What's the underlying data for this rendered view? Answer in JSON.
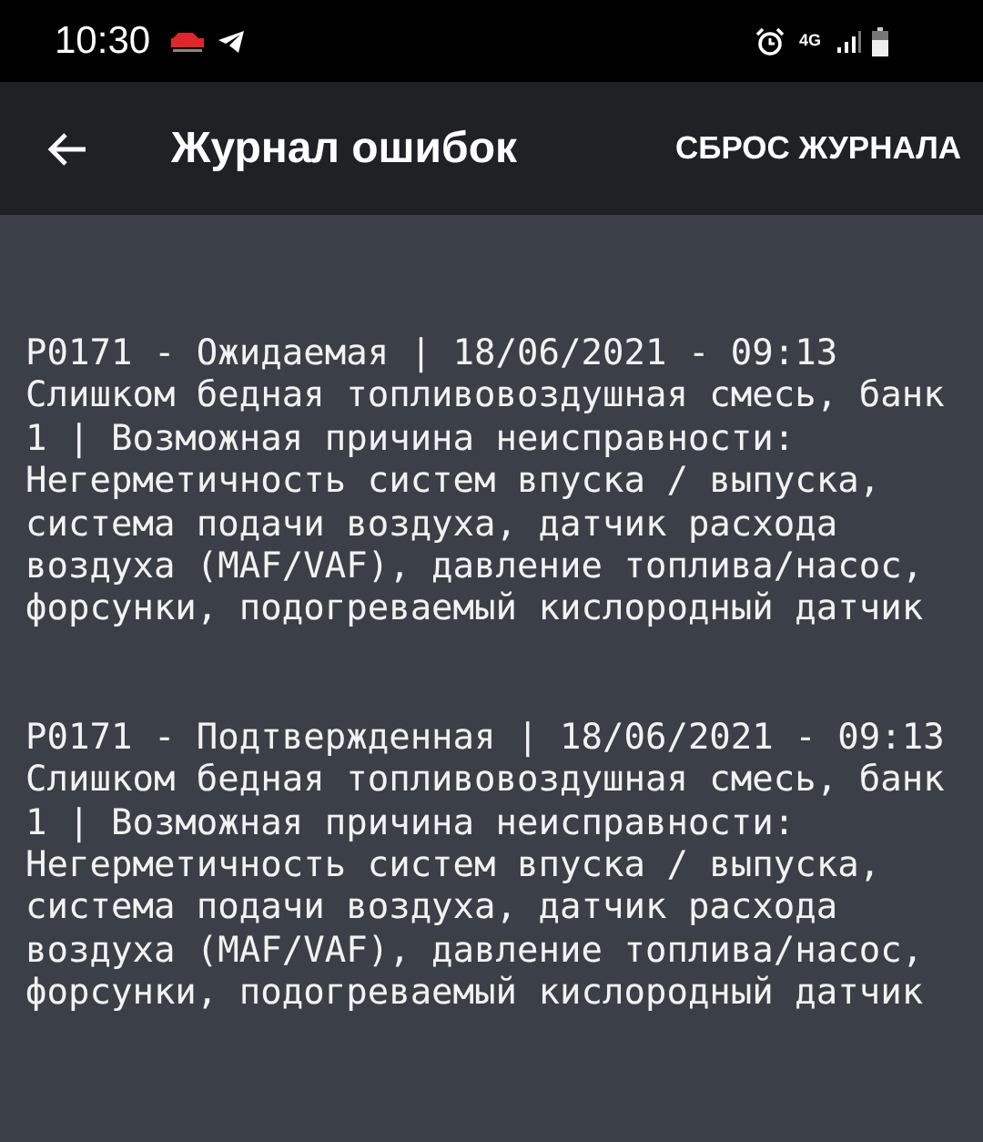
{
  "status_bar": {
    "time": "10:30",
    "network": "4G"
  },
  "app_bar": {
    "title": "Журнал ошибок",
    "action": "СБРОС ЖУРНАЛА"
  },
  "entries": [
    {
      "header": "P0171 - Ожидаемая | 18/06/2021 - 09:13",
      "description": "Слишком бедная топливовоздушная смесь, банк 1 | Возможная причина неисправности: Негерметичность систем впуска / выпуска, система подачи воздуха, датчик расхода воздуха (MAF/VAF), давление топлива/насос, форсунки, подогреваемый кислородный датчик"
    },
    {
      "header": "P0171 - Подтвержденная | 18/06/2021 - 09:13",
      "description": "Слишком бедная топливовоздушная смесь, банк 1 | Возможная причина неисправности: Негерметичность систем впуска / выпуска, система подачи воздуха, датчик расхода воздуха (MAF/VAF), давление топлива/насос, форсунки, подогреваемый кислородный датчик"
    }
  ]
}
